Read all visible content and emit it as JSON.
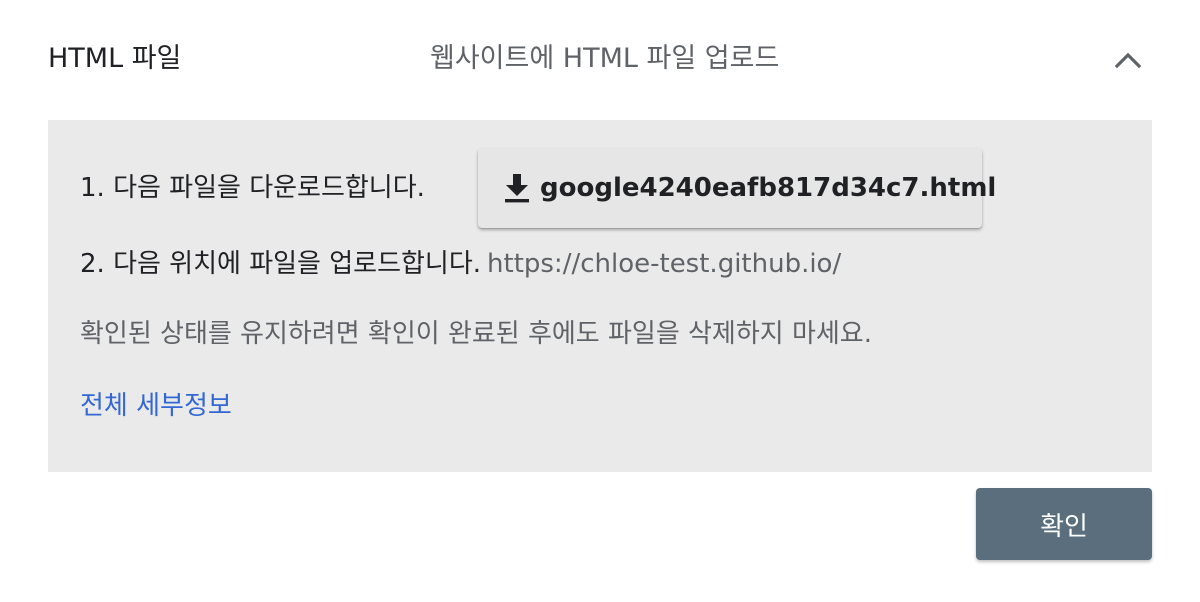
{
  "header": {
    "title": "HTML 파일",
    "subtitle": "웹사이트에 HTML 파일 업로드",
    "toggle_icon": "chevron-up-icon"
  },
  "panel": {
    "step1": {
      "text": "1. 다음 파일을 다운로드합니다.",
      "download_icon": "download-icon",
      "download_label": "google4240eafb817d34c7.html"
    },
    "step2": {
      "text": "2. 다음 위치에 파일을 업로드합니다.",
      "url": "https://chloe-test.github.io/"
    },
    "note": "확인된 상태를 유지하려면 확인이 완료된 후에도 파일을 삭제하지 마세요.",
    "details_link": "전체 세부정보"
  },
  "footer": {
    "confirm_label": "확인"
  },
  "colors": {
    "panel_background": "#eaeaea",
    "link": "#3367d6",
    "confirm_button": "#5a6e7e"
  }
}
